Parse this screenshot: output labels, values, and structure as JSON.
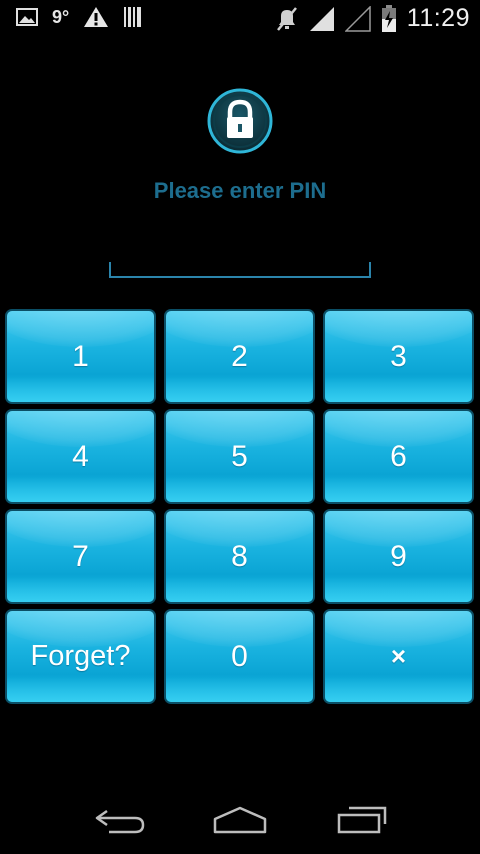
{
  "status_bar": {
    "temperature": "9°",
    "time": "11:29",
    "icons": [
      "image-icon",
      "warning-icon",
      "barcode-icon",
      "mute-icon",
      "signal-icon",
      "signal-empty-icon",
      "battery-icon"
    ]
  },
  "lock_screen": {
    "prompt": "Please enter PIN",
    "pin_value": "",
    "accent_color": "#1d6d8e",
    "key_color": "#1ab3e0"
  },
  "keypad": {
    "keys": [
      {
        "label": "1"
      },
      {
        "label": "2"
      },
      {
        "label": "3"
      },
      {
        "label": "4"
      },
      {
        "label": "5"
      },
      {
        "label": "6"
      },
      {
        "label": "7"
      },
      {
        "label": "8"
      },
      {
        "label": "9"
      },
      {
        "label": "Forget?"
      },
      {
        "label": "0"
      },
      {
        "label": "×"
      }
    ]
  },
  "nav_bar": {
    "buttons": [
      "back-icon",
      "home-icon",
      "recent-apps-icon"
    ]
  }
}
